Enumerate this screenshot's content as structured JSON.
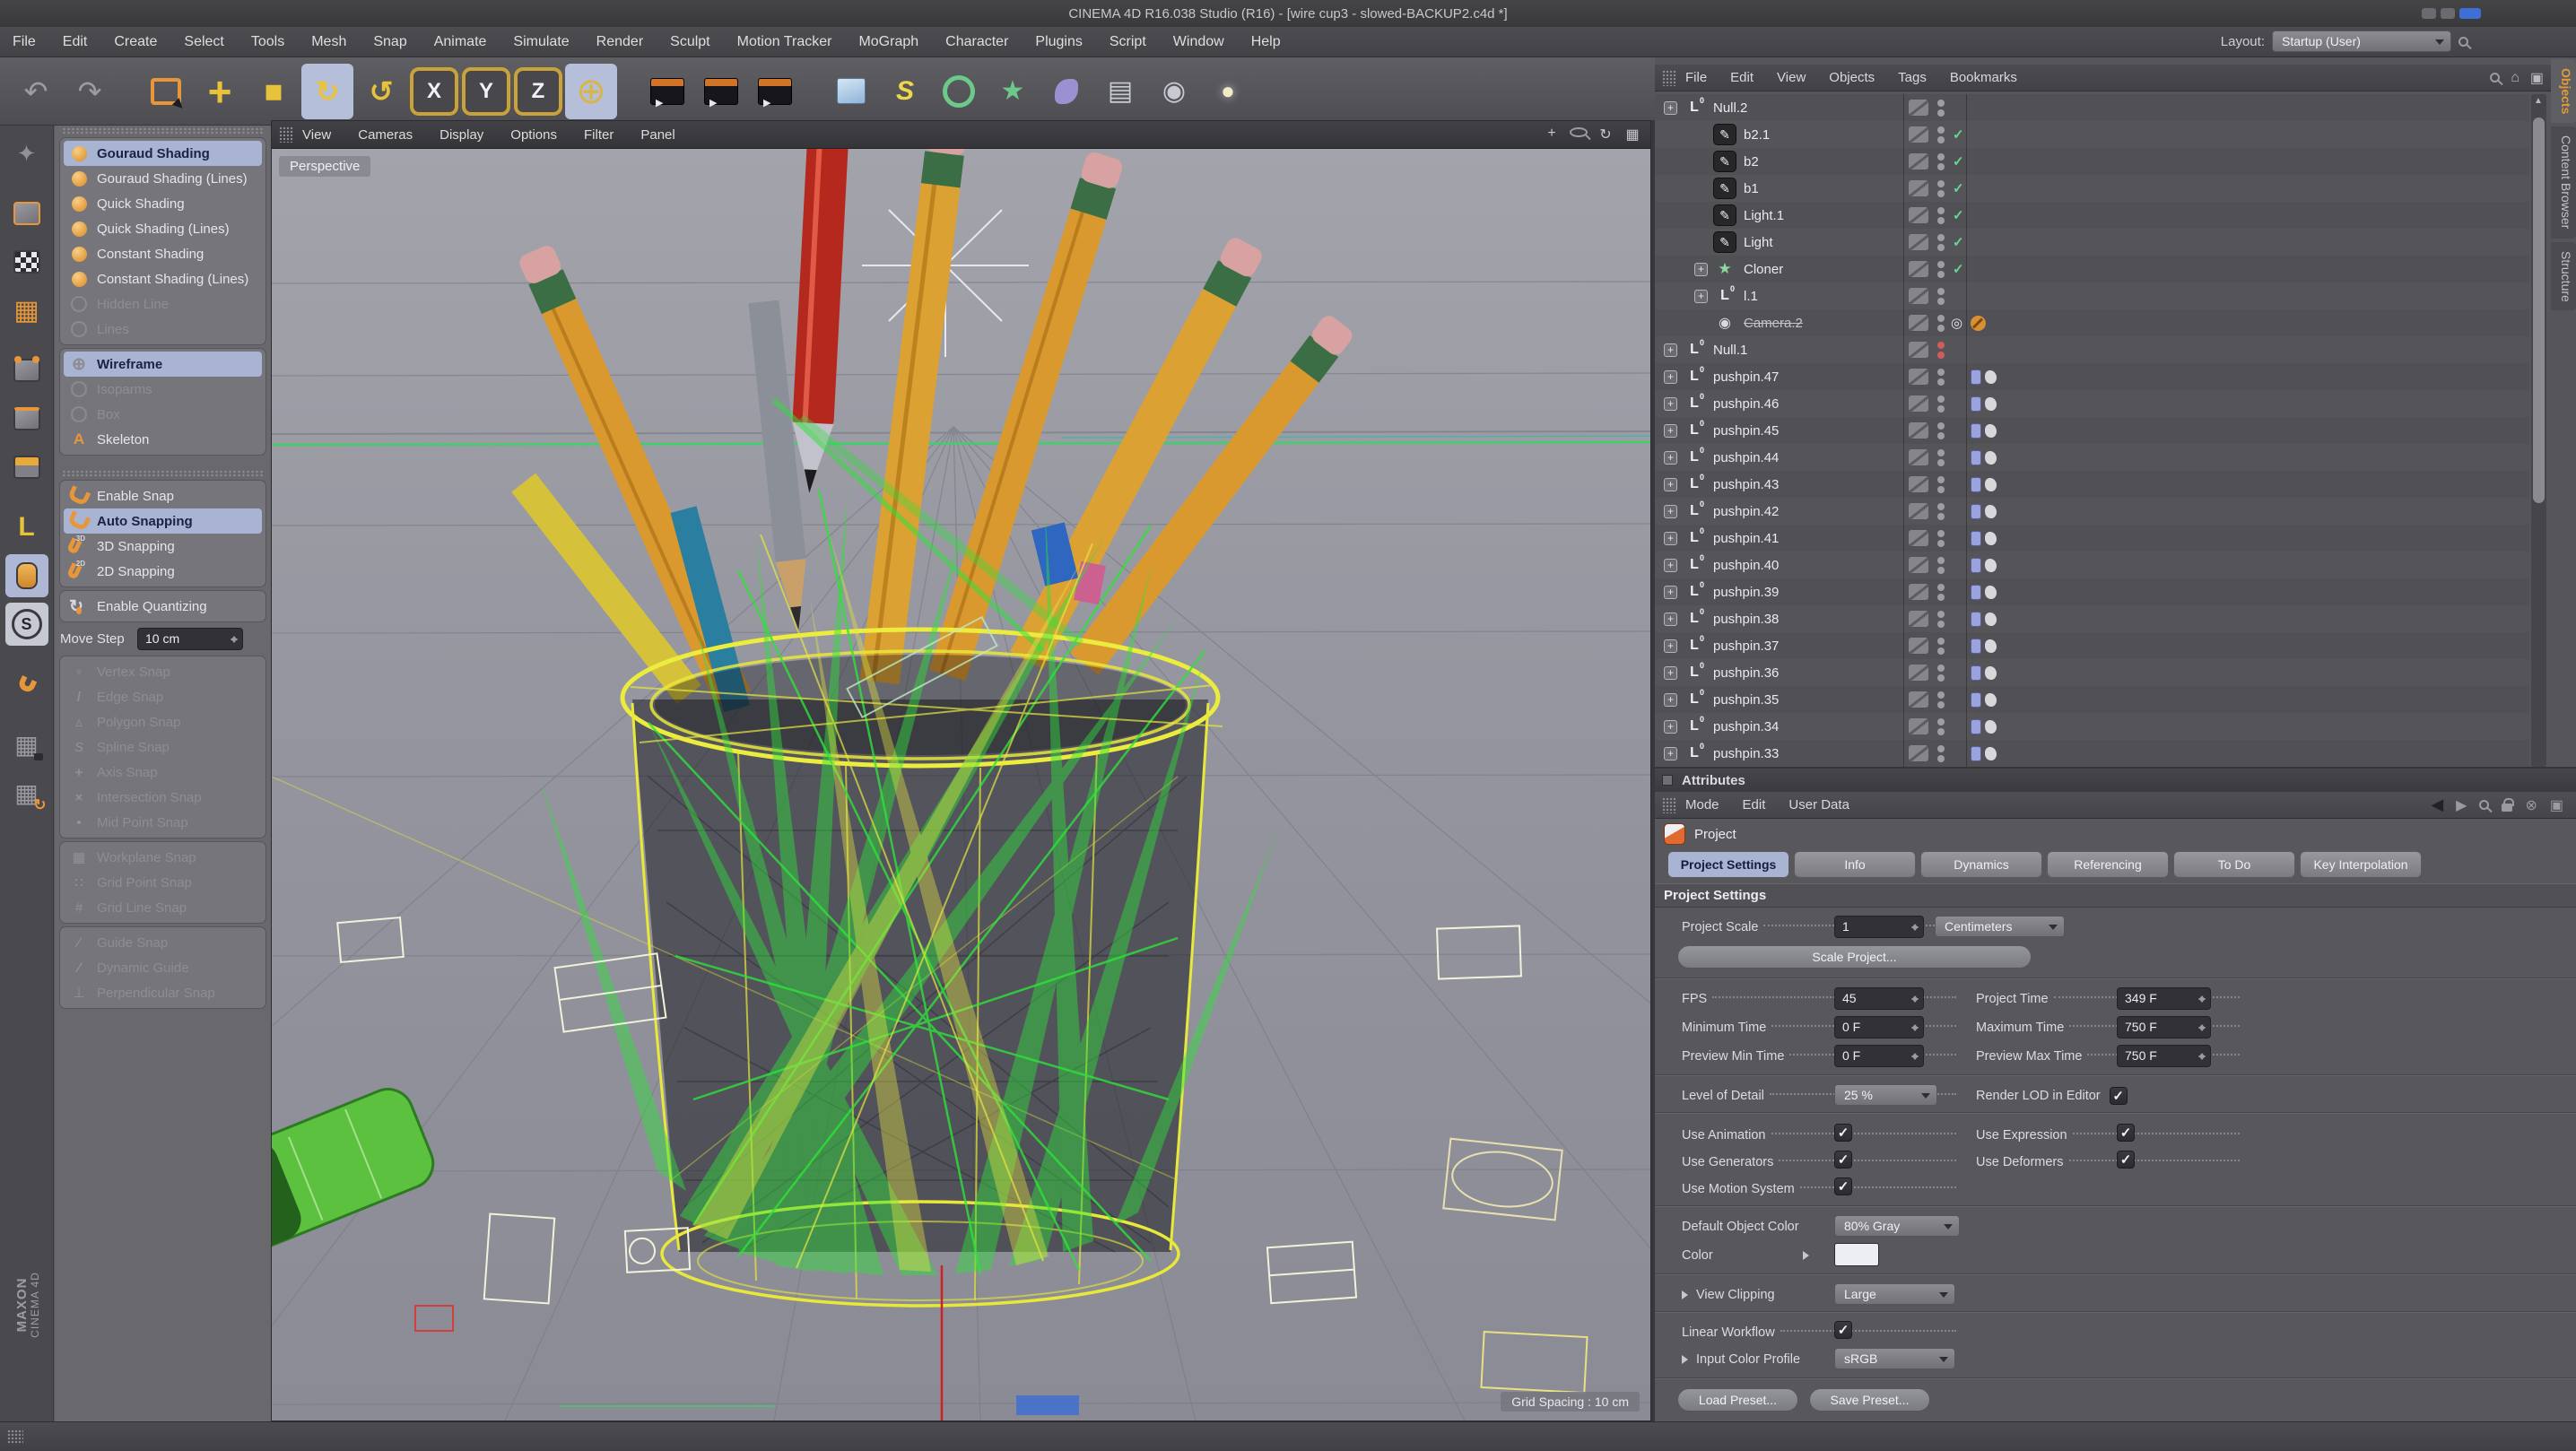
{
  "window": {
    "title": "CINEMA 4D R16.038 Studio (R16) - [wire cup3 - slowed-BACKUP2.c4d *]",
    "layout_label": "Layout:",
    "layout_value": "Startup (User)"
  },
  "menu_bar": {
    "items": [
      "File",
      "Edit",
      "Create",
      "Select",
      "Tools",
      "Mesh",
      "Snap",
      "Animate",
      "Simulate",
      "Render",
      "Sculpt",
      "Motion Tracker",
      "MoGraph",
      "Character",
      "Plugins",
      "Script",
      "Window",
      "Help"
    ]
  },
  "toolbar": {
    "items": [
      {
        "icon": "undo"
      },
      {
        "icon": "redo"
      },
      {
        "icon": "live-selection",
        "gap": true
      },
      {
        "icon": "move"
      },
      {
        "icon": "scale"
      },
      {
        "icon": "rotate",
        "active": true
      },
      {
        "icon": "last-rotate"
      },
      {
        "icon": "axis-x",
        "axis": true,
        "label": "X",
        "gap": true,
        "active": true
      },
      {
        "icon": "axis-y",
        "axis": true,
        "label": "Y",
        "active": true
      },
      {
        "icon": "axis-z",
        "axis": true,
        "label": "Z",
        "active": true
      },
      {
        "icon": "coordinate-system",
        "active": true
      },
      {
        "icon": "render-view",
        "render": true,
        "gap": true
      },
      {
        "icon": "render-picture-viewer",
        "render": true
      },
      {
        "icon": "render-settings",
        "render": true
      },
      {
        "icon": "add-cube",
        "gap": true
      },
      {
        "icon": "add-spline"
      },
      {
        "icon": "add-generator"
      },
      {
        "icon": "add-mograph"
      },
      {
        "icon": "add-deformer"
      },
      {
        "icon": "add-floor"
      },
      {
        "icon": "add-camera"
      },
      {
        "icon": "add-light"
      }
    ]
  },
  "left_toolbar": {
    "items": [
      {
        "icon": "make-editable"
      },
      {
        "icon": "model-mode",
        "cube": true,
        "gap": true
      },
      {
        "icon": "texture-mode",
        "cube": true
      },
      {
        "icon": "workplane-mode"
      },
      {
        "icon": "points-mode",
        "cube": true,
        "pts": true,
        "gap": true
      },
      {
        "icon": "edges-mode",
        "cube": true
      },
      {
        "icon": "polygons-mode",
        "cube": true
      },
      {
        "icon": "axis-mode",
        "gap": true
      },
      {
        "icon": "mouse-mode",
        "active": true
      },
      {
        "icon": "s-mode",
        "lite": true
      },
      {
        "icon": "snap-magnet",
        "magnet": true,
        "gap": true
      },
      {
        "icon": "workplane-lock",
        "gap": true
      },
      {
        "icon": "workplane-cycle"
      }
    ]
  },
  "shading_panel": {
    "group1": [
      {
        "label": "Gouraud Shading",
        "icon": "shaded-sphere",
        "sel": true
      },
      {
        "label": "Gouraud Shading (Lines)",
        "icon": "shaded-sphere"
      },
      {
        "label": "Quick Shading",
        "icon": "shaded-sphere"
      },
      {
        "label": "Quick Shading (Lines)",
        "icon": "shaded-sphere"
      },
      {
        "label": "Constant Shading",
        "icon": "shaded-sphere"
      },
      {
        "label": "Constant Shading (Lines)",
        "icon": "shaded-sphere"
      },
      {
        "label": "Hidden Line",
        "icon": "outline-sphere",
        "dim": true
      },
      {
        "label": "Lines",
        "icon": "outline-sphere",
        "dim": true
      }
    ],
    "group2": [
      {
        "label": "Wireframe",
        "icon": "wire-sphere",
        "sel": true
      },
      {
        "label": "Isoparms",
        "icon": "outline-sphere",
        "dim": true
      },
      {
        "label": "Box",
        "icon": "outline-sphere",
        "dim": true
      },
      {
        "label": "Skeleton",
        "icon": "skeleton"
      }
    ]
  },
  "snapping": {
    "group_main": [
      {
        "label": "Enable Snap",
        "icon": "magnet"
      },
      {
        "label": "Auto Snapping",
        "icon": "magnet-auto",
        "sel": true
      },
      {
        "label": "3D Snapping",
        "icon": "magnet-3d"
      },
      {
        "label": "2D Snapping",
        "icon": "magnet-2d"
      }
    ],
    "group_quantize": [
      {
        "label": "Enable Quantizing",
        "icon": "quantize"
      }
    ],
    "move_step": {
      "label": "Move Step",
      "value": "10 cm"
    },
    "group_component": [
      {
        "label": "Vertex Snap",
        "icon": "vertex-snap",
        "dim": true
      },
      {
        "label": "Edge Snap",
        "icon": "edge-snap",
        "dim": true
      },
      {
        "label": "Polygon Snap",
        "icon": "polygon-snap",
        "dim": true
      },
      {
        "label": "Spline Snap",
        "icon": "spline-snap",
        "dim": true
      },
      {
        "label": "Axis Snap",
        "icon": "axis-snap",
        "dim": true
      },
      {
        "label": "Intersection Snap",
        "icon": "intersection-snap",
        "dim": true
      },
      {
        "label": "Mid Point Snap",
        "icon": "midpoint-snap",
        "dim": true
      }
    ],
    "group_grid": [
      {
        "label": "Workplane Snap",
        "icon": "workplane-snap",
        "dim": true
      },
      {
        "label": "Grid Point Snap",
        "icon": "gridpoint-snap",
        "dim": true
      },
      {
        "label": "Grid Line Snap",
        "icon": "gridline-snap",
        "dim": true
      }
    ],
    "group_guide": [
      {
        "label": "Guide Snap",
        "icon": "guide-snap",
        "dim": true
      },
      {
        "label": "Dynamic Guide",
        "icon": "dynamic-guide",
        "dim": true
      },
      {
        "label": "Perpendicular Snap",
        "icon": "perpendicular-snap",
        "dim": true
      }
    ]
  },
  "viewport": {
    "menus": [
      "View",
      "Cameras",
      "Display",
      "Options",
      "Filter",
      "Panel"
    ],
    "camera_label": "Perspective",
    "grid_spacing": "Grid Spacing : 10 cm"
  },
  "object_manager": {
    "menus": [
      "File",
      "Edit",
      "View",
      "Objects",
      "Tags",
      "Bookmarks"
    ],
    "side_tabs": [
      {
        "label": "Objects",
        "active": true
      },
      {
        "label": "Content Browser"
      },
      {
        "label": "Structure"
      }
    ],
    "objects": [
      {
        "name": "Null.2",
        "depth": 0,
        "icon": "null",
        "exp": true,
        "dots": "gray"
      },
      {
        "name": "b2.1",
        "depth": 1,
        "icon": "pen",
        "dots": "gray",
        "check": true
      },
      {
        "name": "b2",
        "depth": 1,
        "icon": "pen",
        "dots": "gray",
        "check": true
      },
      {
        "name": "b1",
        "depth": 1,
        "icon": "pen",
        "dots": "gray",
        "check": true
      },
      {
        "name": "Light.1",
        "depth": 1,
        "icon": "pen",
        "dots": "gray",
        "check": true
      },
      {
        "name": "Light",
        "depth": 1,
        "icon": "pen",
        "dots": "gray",
        "check": true
      },
      {
        "name": "Cloner",
        "depth": 1,
        "icon": "cloner",
        "exp": true,
        "dots": "gray",
        "check": true
      },
      {
        "name": "l.1",
        "depth": 1,
        "icon": "null",
        "exp": true,
        "dots": "gray"
      },
      {
        "name": "Camera.2",
        "depth": 1,
        "icon": "camera",
        "dots": "gray",
        "target": true,
        "strike": true,
        "tagNo": true
      },
      {
        "name": "Null.1",
        "depth": 0,
        "icon": "null",
        "exp": true,
        "dots": "red"
      },
      {
        "name": "pushpin.47",
        "depth": 0,
        "icon": "null",
        "exp": true,
        "dots": "gray",
        "tagBlue": true,
        "tagRock": true
      },
      {
        "name": "pushpin.46",
        "depth": 0,
        "icon": "null",
        "exp": true,
        "dots": "gray",
        "tagBlue": true,
        "tagRock": true
      },
      {
        "name": "pushpin.45",
        "depth": 0,
        "icon": "null",
        "exp": true,
        "dots": "gray",
        "tagBlue": true,
        "tagRock": true
      },
      {
        "name": "pushpin.44",
        "depth": 0,
        "icon": "null",
        "exp": true,
        "dots": "gray",
        "tagBlue": true,
        "tagRock": true
      },
      {
        "name": "pushpin.43",
        "depth": 0,
        "icon": "null",
        "exp": true,
        "dots": "gray",
        "tagBlue": true,
        "tagRock": true
      },
      {
        "name": "pushpin.42",
        "depth": 0,
        "icon": "null",
        "exp": true,
        "dots": "gray",
        "tagBlue": true,
        "tagRock": true
      },
      {
        "name": "pushpin.41",
        "depth": 0,
        "icon": "null",
        "exp": true,
        "dots": "gray",
        "tagBlue": true,
        "tagRock": true
      },
      {
        "name": "pushpin.40",
        "depth": 0,
        "icon": "null",
        "exp": true,
        "dots": "gray",
        "tagBlue": true,
        "tagRock": true
      },
      {
        "name": "pushpin.39",
        "depth": 0,
        "icon": "null",
        "exp": true,
        "dots": "gray",
        "tagBlue": true,
        "tagRock": true
      },
      {
        "name": "pushpin.38",
        "depth": 0,
        "icon": "null",
        "exp": true,
        "dots": "gray",
        "tagBlue": true,
        "tagRock": true
      },
      {
        "name": "pushpin.37",
        "depth": 0,
        "icon": "null",
        "exp": true,
        "dots": "gray",
        "tagBlue": true,
        "tagRock": true
      },
      {
        "name": "pushpin.36",
        "depth": 0,
        "icon": "null",
        "exp": true,
        "dots": "gray",
        "tagBlue": true,
        "tagRock": true
      },
      {
        "name": "pushpin.35",
        "depth": 0,
        "icon": "null",
        "exp": true,
        "dots": "gray",
        "tagBlue": true,
        "tagRock": true
      },
      {
        "name": "pushpin.34",
        "depth": 0,
        "icon": "null",
        "exp": true,
        "dots": "gray",
        "tagBlue": true,
        "tagRock": true
      },
      {
        "name": "pushpin.33",
        "depth": 0,
        "icon": "null",
        "exp": true,
        "dots": "gray",
        "tagBlue": true,
        "tagRock": true
      }
    ]
  },
  "attributes": {
    "title": "Attributes",
    "menus": [
      "Mode",
      "Edit",
      "User Data"
    ],
    "object_label": "Project",
    "tabs": [
      {
        "label": "Project Settings",
        "active": true
      },
      {
        "label": "Info"
      },
      {
        "label": "Dynamics"
      },
      {
        "label": "Referencing"
      },
      {
        "label": "To Do"
      },
      {
        "label": "Key Interpolation"
      }
    ],
    "section": "Project Settings",
    "project": {
      "scale_label": "Project Scale",
      "scale_value": "1",
      "scale_unit": "Centimeters",
      "scale_button": "Scale Project...",
      "fps_label": "FPS",
      "fps_value": "45",
      "project_time_label": "Project Time",
      "project_time_value": "349 F",
      "min_time_label": "Minimum Time",
      "min_time_value": "0 F",
      "max_time_label": "Maximum Time",
      "max_time_value": "750 F",
      "preview_min_label": "Preview Min Time",
      "preview_min_value": "0 F",
      "preview_max_label": "Preview Max Time",
      "preview_max_value": "750 F",
      "lod_label": "Level of Detail",
      "lod_value": "25 %",
      "render_lod_label": "Render LOD in Editor",
      "use_animation_label": "Use Animation",
      "use_expression_label": "Use Expression",
      "use_generators_label": "Use Generators",
      "use_deformers_label": "Use Deformers",
      "use_motion_label": "Use Motion System",
      "default_color_label": "Default Object Color",
      "default_color_value": "80% Gray",
      "color_label": "Color",
      "view_clipping_label": "View Clipping",
      "view_clipping_value": "Large",
      "linear_workflow_label": "Linear Workflow",
      "input_profile_label": "Input Color Profile",
      "input_profile_value": "sRGB",
      "load_button": "Load Preset...",
      "save_button": "Save Preset..."
    }
  },
  "branding": {
    "line1": "MAXON",
    "line2": "CINEMA 4D"
  },
  "colors": {
    "accent_orange": "#e8963a",
    "selection_blue": "#a9b3d2",
    "wire_green": "#2ee23a",
    "wire_yellow": "#e8e83a",
    "axis_red": "#cc2222"
  }
}
